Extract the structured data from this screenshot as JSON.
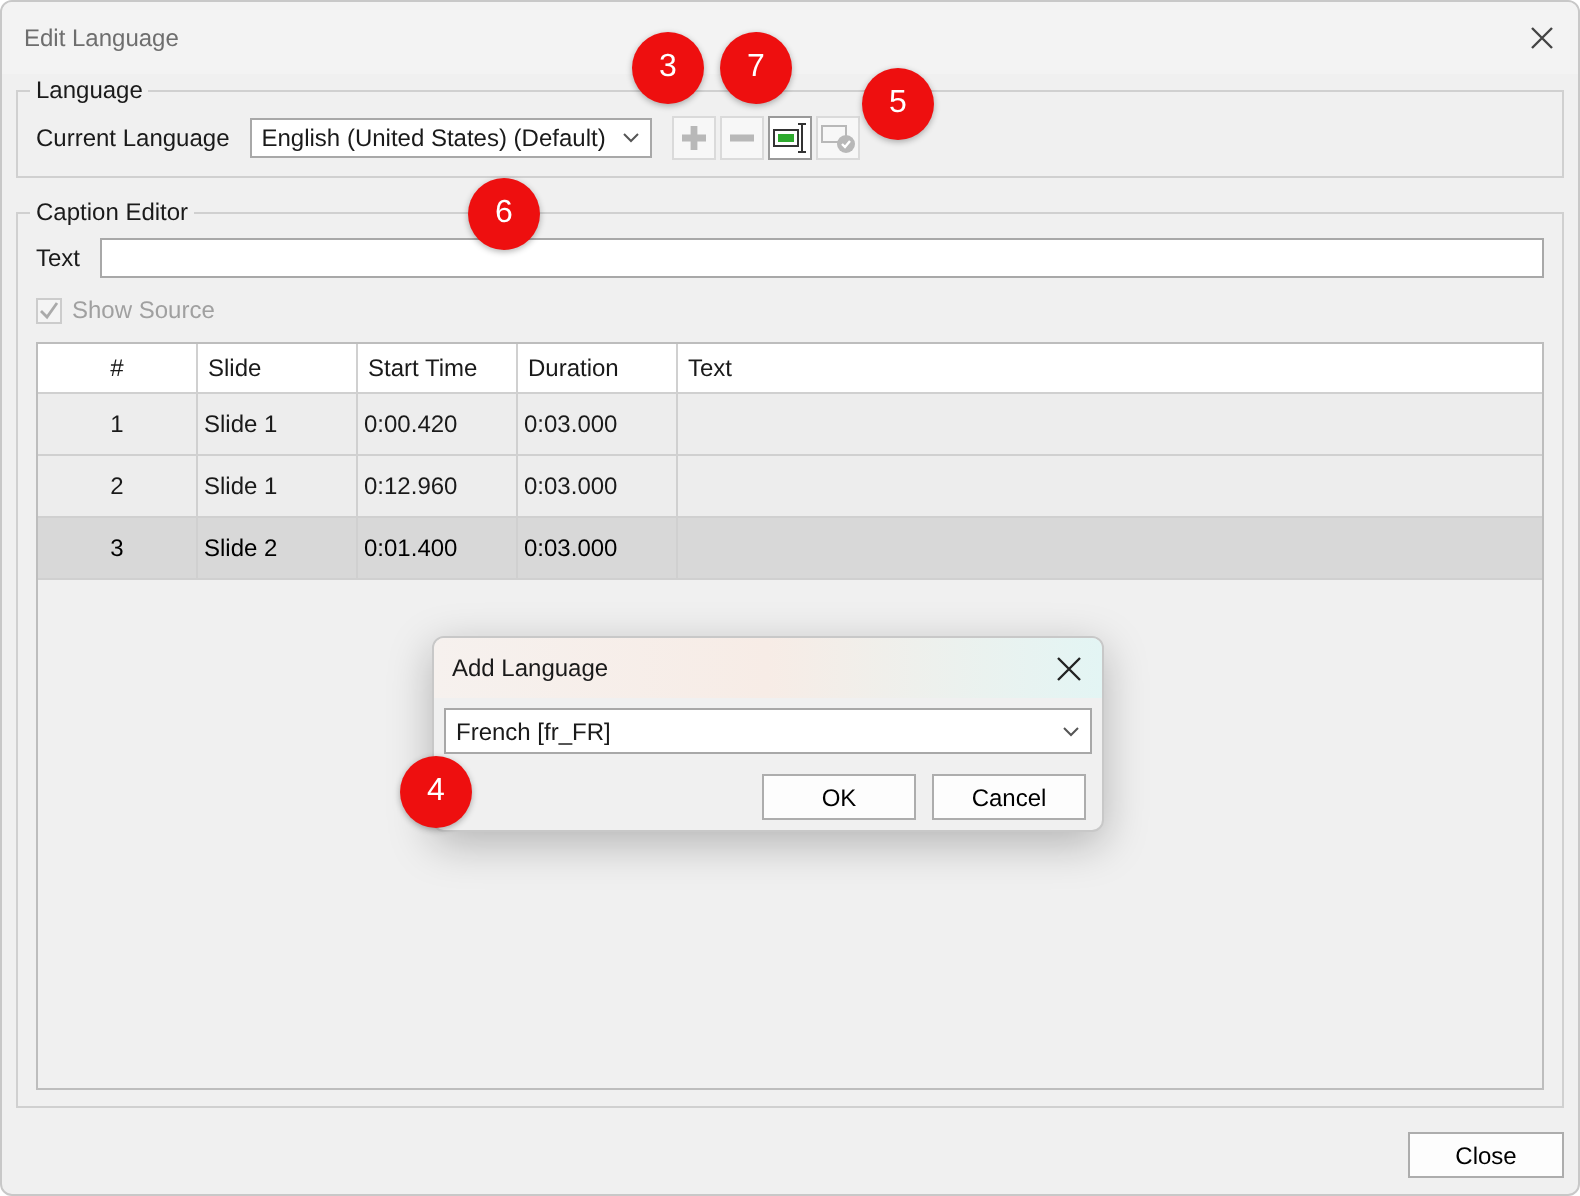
{
  "window": {
    "title": "Edit Language"
  },
  "language_group": {
    "legend": "Language",
    "label": "Current Language",
    "value": "English (United States) (Default)",
    "toolbar": [
      {
        "kind": "add",
        "disabled": true
      },
      {
        "kind": "remove",
        "disabled": true
      },
      {
        "kind": "caption",
        "disabled": false
      },
      {
        "kind": "apply",
        "disabled": true
      }
    ]
  },
  "caption_editor": {
    "legend": "Caption Editor",
    "text_label": "Text",
    "show_source": {
      "label": "Show Source",
      "checked": true,
      "disabled": true
    },
    "table": {
      "columns": [
        "#",
        "Slide",
        "Start Time",
        "Duration",
        "Text"
      ],
      "rows": [
        {
          "cells": [
            "1",
            "Slide 1",
            "0:00.420",
            "0:03.000",
            ""
          ],
          "selected": false
        },
        {
          "cells": [
            "2",
            "Slide 1",
            "0:12.960",
            "0:03.000",
            ""
          ],
          "selected": false
        },
        {
          "cells": [
            "3",
            "Slide 2",
            "0:01.400",
            "0:03.000",
            ""
          ],
          "selected": true
        }
      ]
    }
  },
  "buttons": [
    "Close"
  ],
  "add_language_dialog": {
    "title": "Add Language",
    "value": "French [fr_FR]",
    "buttons": [
      "OK",
      "Cancel"
    ]
  },
  "callouts": [
    {
      "label": "3"
    },
    {
      "label": "7"
    },
    {
      "label": "5"
    },
    {
      "label": "6"
    },
    {
      "label": "4"
    }
  ]
}
